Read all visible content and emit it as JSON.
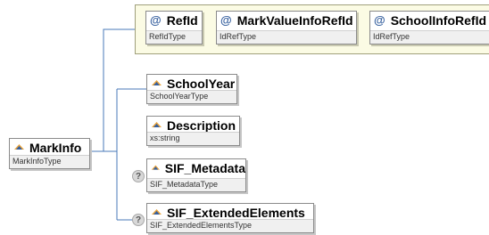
{
  "root": {
    "name": "MarkInfo",
    "type": "MarkInfoType"
  },
  "attributes": [
    {
      "name": "RefId",
      "type": "RefIdType"
    },
    {
      "name": "MarkValueInfoRefId",
      "type": "IdRefType"
    },
    {
      "name": "SchoolInfoRefId",
      "type": "IdRefType"
    }
  ],
  "elements": [
    {
      "name": "SchoolYear",
      "type": "SchoolYearType",
      "optional": false
    },
    {
      "name": "Description",
      "type": "xs:string",
      "optional": false
    },
    {
      "name": "SIF_Metadata",
      "type": "SIF_MetadataType",
      "optional": true
    },
    {
      "name": "SIF_ExtendedElements",
      "type": "SIF_ExtendedElementsType",
      "optional": true
    }
  ],
  "icons": {
    "attribute": "at-sign-icon",
    "element": "element-diamond-icon",
    "optional": "question-mark-icon"
  },
  "colors": {
    "connector": "#4a7ab8",
    "attribute_panel": "#fbfbe4",
    "icon_blue": "#355f9e",
    "icon_orange": "#e8a33c"
  }
}
